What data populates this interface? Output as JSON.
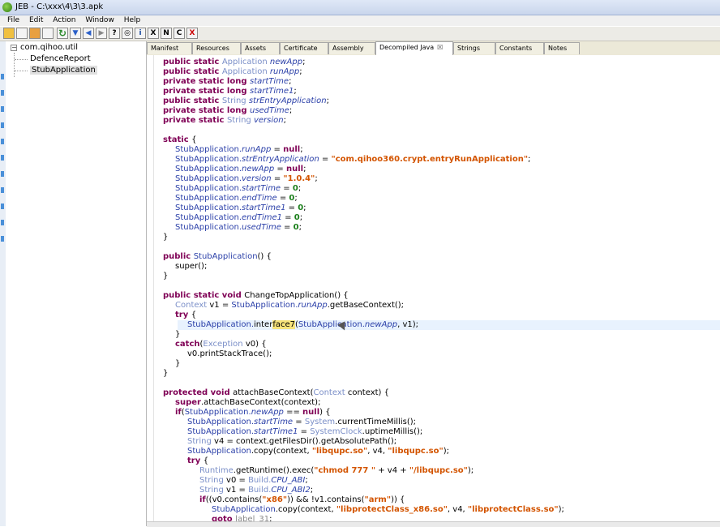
{
  "window": {
    "title": "JEB - C:\\xxx\\4\\3\\3.apk"
  },
  "menu": [
    "File",
    "Edit",
    "Action",
    "Window",
    "Help"
  ],
  "toolbar": {
    "letters": [
      "X",
      "N",
      "C",
      "X"
    ]
  },
  "tree": {
    "root": "com.qihoo.util",
    "expander": "−",
    "children": [
      "DefenceReport",
      "StubApplication"
    ]
  },
  "tabs": [
    "Manifest",
    "Resources",
    "Assets",
    "Certificate",
    "Assembly",
    "Decompiled Java",
    "Strings",
    "Constants",
    "Notes"
  ],
  "active_tab_close": "☒",
  "code": [
    {
      "i": 0,
      "p": [
        [
          "kw",
          "public static "
        ],
        [
          "ty",
          "Application "
        ],
        [
          "fd",
          "newApp"
        ],
        [
          "",
          "; "
        ]
      ]
    },
    {
      "i": 0,
      "p": [
        [
          "kw",
          "public static "
        ],
        [
          "ty",
          "Application "
        ],
        [
          "fd",
          "runApp"
        ],
        [
          "",
          ";"
        ]
      ]
    },
    {
      "i": 0,
      "p": [
        [
          "kw",
          "private static long "
        ],
        [
          "fd",
          "startTime"
        ],
        [
          "",
          ";"
        ]
      ]
    },
    {
      "i": 0,
      "p": [
        [
          "kw",
          "private static long "
        ],
        [
          "fd",
          "startTime1"
        ],
        [
          "",
          ";"
        ]
      ]
    },
    {
      "i": 0,
      "p": [
        [
          "kw",
          "public static "
        ],
        [
          "ty",
          "String "
        ],
        [
          "fd",
          "strEntryApplication"
        ],
        [
          "",
          ";"
        ]
      ]
    },
    {
      "i": 0,
      "p": [
        [
          "kw",
          "private static long "
        ],
        [
          "fd",
          "usedTime"
        ],
        [
          "",
          ";"
        ]
      ]
    },
    {
      "i": 0,
      "p": [
        [
          "kw",
          "private static "
        ],
        [
          "ty",
          "String "
        ],
        [
          "fd",
          "version"
        ],
        [
          "",
          ";"
        ]
      ]
    },
    {
      "i": 0,
      "p": []
    },
    {
      "i": 0,
      "p": [
        [
          "kw",
          "static "
        ],
        [
          "",
          "{"
        ]
      ]
    },
    {
      "i": 1,
      "p": [
        [
          "cl",
          "StubApplication."
        ],
        [
          "fd",
          "runApp"
        ],
        [
          "",
          " = "
        ],
        [
          "kw",
          "null"
        ],
        [
          "",
          ";"
        ]
      ]
    },
    {
      "i": 1,
      "p": [
        [
          "cl",
          "StubApplication."
        ],
        [
          "fd",
          "strEntryApplication"
        ],
        [
          "",
          " = "
        ],
        [
          "st",
          "\"com.qihoo360.crypt.entryRunApplication\""
        ],
        [
          "",
          ";"
        ]
      ]
    },
    {
      "i": 1,
      "p": [
        [
          "cl",
          "StubApplication."
        ],
        [
          "fd",
          "newApp"
        ],
        [
          "",
          " = "
        ],
        [
          "kw",
          "null"
        ],
        [
          "",
          ";"
        ]
      ]
    },
    {
      "i": 1,
      "p": [
        [
          "cl",
          "StubApplication."
        ],
        [
          "fd",
          "version"
        ],
        [
          "",
          " = "
        ],
        [
          "st",
          "\"1.0.4\""
        ],
        [
          "",
          ";"
        ]
      ]
    },
    {
      "i": 1,
      "p": [
        [
          "cl",
          "StubApplication."
        ],
        [
          "fd",
          "startTime"
        ],
        [
          "",
          " = "
        ],
        [
          "nm",
          "0"
        ],
        [
          "",
          ";"
        ]
      ]
    },
    {
      "i": 1,
      "p": [
        [
          "cl",
          "StubApplication."
        ],
        [
          "fd",
          "endTime"
        ],
        [
          "",
          " = "
        ],
        [
          "nm",
          "0"
        ],
        [
          "",
          ";"
        ]
      ]
    },
    {
      "i": 1,
      "p": [
        [
          "cl",
          "StubApplication."
        ],
        [
          "fd",
          "startTime1"
        ],
        [
          "",
          " = "
        ],
        [
          "nm",
          "0"
        ],
        [
          "",
          ";"
        ]
      ]
    },
    {
      "i": 1,
      "p": [
        [
          "cl",
          "StubApplication."
        ],
        [
          "fd",
          "endTime1"
        ],
        [
          "",
          " = "
        ],
        [
          "nm",
          "0"
        ],
        [
          "",
          ";"
        ]
      ]
    },
    {
      "i": 1,
      "p": [
        [
          "cl",
          "StubApplication."
        ],
        [
          "fd",
          "usedTime"
        ],
        [
          "",
          " = "
        ],
        [
          "nm",
          "0"
        ],
        [
          "",
          ";"
        ]
      ]
    },
    {
      "i": 0,
      "p": [
        [
          "",
          "}"
        ]
      ]
    },
    {
      "i": 0,
      "p": []
    },
    {
      "i": 0,
      "p": [
        [
          "kw",
          "public "
        ],
        [
          "cl",
          "StubApplication"
        ],
        [
          "",
          "() {"
        ]
      ]
    },
    {
      "i": 1,
      "p": [
        [
          "",
          "super();"
        ]
      ]
    },
    {
      "i": 0,
      "p": [
        [
          "",
          "}"
        ]
      ]
    },
    {
      "i": 0,
      "p": []
    },
    {
      "i": 0,
      "p": [
        [
          "kw",
          "public static void "
        ],
        [
          "",
          "ChangeTopApplication() {"
        ]
      ]
    },
    {
      "i": 1,
      "p": [
        [
          "ty",
          "Context "
        ],
        [
          "",
          "v1 = "
        ],
        [
          "cl",
          "StubApplication."
        ],
        [
          "fd",
          "runApp"
        ],
        [
          "",
          ".getBaseContext();"
        ]
      ]
    },
    {
      "i": 1,
      "p": [
        [
          "kw",
          "try "
        ],
        [
          "",
          "{"
        ]
      ]
    },
    {
      "i": 2,
      "hl": true,
      "p": [
        [
          "cl",
          "StubApplication."
        ],
        [
          "",
          "inter"
        ],
        [
          "sel",
          "face7"
        ],
        [
          "",
          "("
        ],
        [
          "cl",
          "StubApplication."
        ],
        [
          "fd",
          "newApp"
        ],
        [
          "",
          ", v1);"
        ]
      ]
    },
    {
      "i": 1,
      "p": [
        [
          "",
          "}"
        ]
      ]
    },
    {
      "i": 1,
      "p": [
        [
          "kw",
          "catch"
        ],
        [
          "",
          "("
        ],
        [
          "ty",
          "Exception "
        ],
        [
          "",
          "v0) {"
        ]
      ]
    },
    {
      "i": 2,
      "p": [
        [
          "",
          "v0.printStackTrace();"
        ]
      ]
    },
    {
      "i": 1,
      "p": [
        [
          "",
          "}"
        ]
      ]
    },
    {
      "i": 0,
      "p": [
        [
          "",
          "}"
        ]
      ]
    },
    {
      "i": 0,
      "p": []
    },
    {
      "i": 0,
      "p": [
        [
          "kw",
          "protected void "
        ],
        [
          "",
          "attachBaseContext("
        ],
        [
          "ty",
          "Context "
        ],
        [
          "",
          "context) {"
        ]
      ]
    },
    {
      "i": 1,
      "p": [
        [
          "kw",
          "super"
        ],
        [
          "",
          ".attachBaseContext(context);"
        ]
      ]
    },
    {
      "i": 1,
      "p": [
        [
          "kw",
          "if"
        ],
        [
          "",
          "("
        ],
        [
          "cl",
          "StubApplication."
        ],
        [
          "fd",
          "newApp"
        ],
        [
          "",
          " == "
        ],
        [
          "kw",
          "null"
        ],
        [
          "",
          ") {"
        ]
      ]
    },
    {
      "i": 2,
      "p": [
        [
          "cl",
          "StubApplication."
        ],
        [
          "fd",
          "startTime"
        ],
        [
          "",
          " = "
        ],
        [
          "ty",
          "System"
        ],
        [
          "",
          ".currentTimeMillis();"
        ]
      ]
    },
    {
      "i": 2,
      "p": [
        [
          "cl",
          "StubApplication."
        ],
        [
          "fd",
          "startTime1"
        ],
        [
          "",
          " = "
        ],
        [
          "ty",
          "SystemClock"
        ],
        [
          "",
          ".uptimeMillis();"
        ]
      ]
    },
    {
      "i": 2,
      "p": [
        [
          "ty",
          "String "
        ],
        [
          "",
          "v4 = context.getFilesDir().getAbsolutePath();"
        ]
      ]
    },
    {
      "i": 2,
      "p": [
        [
          "cl",
          "StubApplication"
        ],
        [
          "",
          ".copy(context, "
        ],
        [
          "st",
          "\"libqupc.so\""
        ],
        [
          "",
          ", v4, "
        ],
        [
          "st",
          "\"libqupc.so\""
        ],
        [
          "",
          ");"
        ]
      ]
    },
    {
      "i": 2,
      "p": [
        [
          "kw",
          "try "
        ],
        [
          "",
          "{"
        ]
      ]
    },
    {
      "i": 3,
      "p": [
        [
          "ty",
          "Runtime"
        ],
        [
          "",
          ".getRuntime().exec("
        ],
        [
          "st",
          "\"chmod 777 \""
        ],
        [
          "",
          " + v4 + "
        ],
        [
          "st",
          "\"/libqupc.so\""
        ],
        [
          "",
          ");"
        ]
      ]
    },
    {
      "i": 3,
      "p": [
        [
          "ty",
          "String "
        ],
        [
          "",
          "v0 = "
        ],
        [
          "ty",
          "Build."
        ],
        [
          "fd",
          "CPU_ABI"
        ],
        [
          "",
          ";"
        ]
      ]
    },
    {
      "i": 3,
      "p": [
        [
          "ty",
          "String "
        ],
        [
          "",
          "v1 = "
        ],
        [
          "ty",
          "Build."
        ],
        [
          "fd",
          "CPU_ABI2"
        ],
        [
          "",
          ";"
        ]
      ]
    },
    {
      "i": 3,
      "p": [
        [
          "kw",
          "if"
        ],
        [
          "",
          "((v0.contains("
        ],
        [
          "st",
          "\"x86\""
        ],
        [
          "",
          ")) && !v1.contains("
        ],
        [
          "st",
          "\"arm\""
        ],
        [
          "",
          ")) {"
        ]
      ]
    },
    {
      "i": 4,
      "p": [
        [
          "cl",
          "StubApplication"
        ],
        [
          "",
          ".copy(context, "
        ],
        [
          "st",
          "\"libprotectClass_x86.so\""
        ],
        [
          "",
          ", v4, "
        ],
        [
          "st",
          "\"libprotectClass.so\""
        ],
        [
          "",
          ");"
        ]
      ]
    },
    {
      "i": 4,
      "p": [
        [
          "kw",
          "goto "
        ],
        [
          "gy",
          "label_31"
        ],
        [
          "",
          ";"
        ]
      ]
    },
    {
      "i": 3,
      "p": [
        [
          "",
          "}"
        ]
      ]
    }
  ]
}
